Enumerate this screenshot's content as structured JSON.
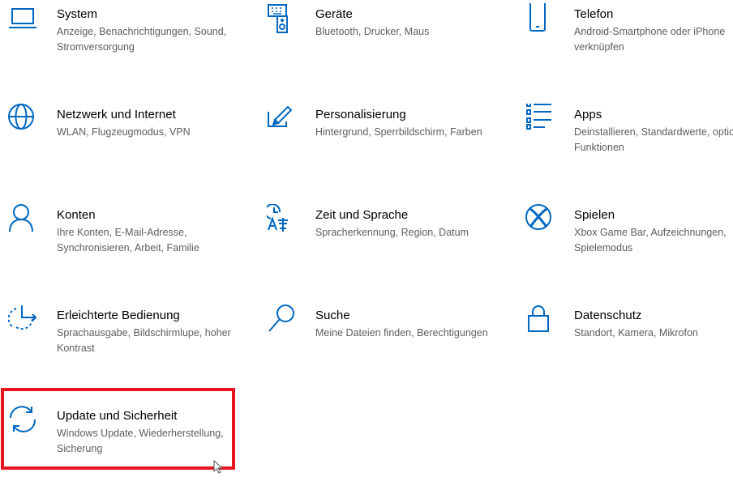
{
  "accent": "#0067c0",
  "highlight_color": "#e8141d",
  "tiles": [
    {
      "icon": "laptop-icon",
      "title": "System",
      "desc": "Anzeige, Benachrichtigungen, Sound, Stromversorgung"
    },
    {
      "icon": "keyboard-speaker-icon",
      "title": "Geräte",
      "desc": "Bluetooth, Drucker, Maus"
    },
    {
      "icon": "phone-icon",
      "title": "Telefon",
      "desc": "Android-Smartphone oder iPhone verknüpfen"
    },
    {
      "icon": "globe-icon",
      "title": "Netzwerk und Internet",
      "desc": "WLAN, Flugzeugmodus, VPN"
    },
    {
      "icon": "pen-tablet-icon",
      "title": "Personalisierung",
      "desc": "Hintergrund, Sperrbildschirm, Farben"
    },
    {
      "icon": "apps-list-icon",
      "title": "Apps",
      "desc": "Deinstallieren, Standardwerte, optionale Funktionen"
    },
    {
      "icon": "person-icon",
      "title": "Konten",
      "desc": "Ihre Konten, E-Mail-Adresse, Synchronisieren, Arbeit, Familie"
    },
    {
      "icon": "time-language-icon",
      "title": "Zeit und Sprache",
      "desc": "Spracherkennung, Region, Datum"
    },
    {
      "icon": "xbox-icon",
      "title": "Spielen",
      "desc": "Xbox Game Bar, Aufzeichnungen, Spielemodus"
    },
    {
      "icon": "ease-of-access-icon",
      "title": "Erleichterte Bedienung",
      "desc": "Sprachausgabe, Bildschirmlupe, hoher Kontrast"
    },
    {
      "icon": "search-icon",
      "title": "Suche",
      "desc": "Meine Dateien finden, Berechtigungen"
    },
    {
      "icon": "lock-icon",
      "title": "Datenschutz",
      "desc": "Standort, Kamera, Mikrofon"
    },
    {
      "icon": "sync-icon",
      "title": "Update und Sicherheit",
      "desc": "Windows Update, Wiederherstellung, Sicherung"
    }
  ]
}
